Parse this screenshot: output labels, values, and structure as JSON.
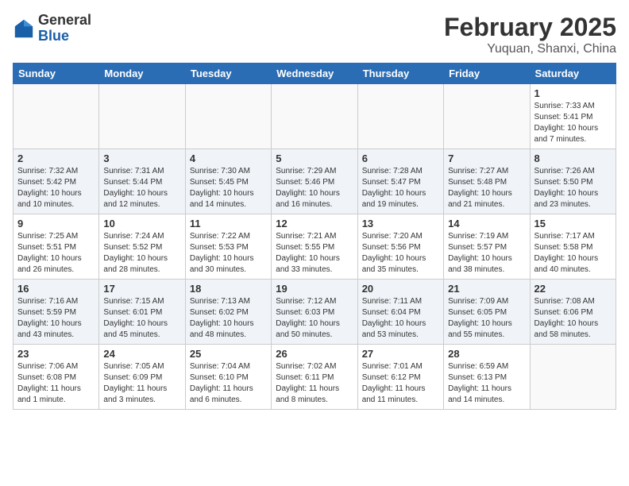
{
  "header": {
    "logo_general": "General",
    "logo_blue": "Blue",
    "month": "February 2025",
    "location": "Yuquan, Shanxi, China"
  },
  "weekdays": [
    "Sunday",
    "Monday",
    "Tuesday",
    "Wednesday",
    "Thursday",
    "Friday",
    "Saturday"
  ],
  "weeks": [
    [
      {
        "day": "",
        "info": ""
      },
      {
        "day": "",
        "info": ""
      },
      {
        "day": "",
        "info": ""
      },
      {
        "day": "",
        "info": ""
      },
      {
        "day": "",
        "info": ""
      },
      {
        "day": "",
        "info": ""
      },
      {
        "day": "1",
        "info": "Sunrise: 7:33 AM\nSunset: 5:41 PM\nDaylight: 10 hours and 7 minutes."
      }
    ],
    [
      {
        "day": "2",
        "info": "Sunrise: 7:32 AM\nSunset: 5:42 PM\nDaylight: 10 hours and 10 minutes."
      },
      {
        "day": "3",
        "info": "Sunrise: 7:31 AM\nSunset: 5:44 PM\nDaylight: 10 hours and 12 minutes."
      },
      {
        "day": "4",
        "info": "Sunrise: 7:30 AM\nSunset: 5:45 PM\nDaylight: 10 hours and 14 minutes."
      },
      {
        "day": "5",
        "info": "Sunrise: 7:29 AM\nSunset: 5:46 PM\nDaylight: 10 hours and 16 minutes."
      },
      {
        "day": "6",
        "info": "Sunrise: 7:28 AM\nSunset: 5:47 PM\nDaylight: 10 hours and 19 minutes."
      },
      {
        "day": "7",
        "info": "Sunrise: 7:27 AM\nSunset: 5:48 PM\nDaylight: 10 hours and 21 minutes."
      },
      {
        "day": "8",
        "info": "Sunrise: 7:26 AM\nSunset: 5:50 PM\nDaylight: 10 hours and 23 minutes."
      }
    ],
    [
      {
        "day": "9",
        "info": "Sunrise: 7:25 AM\nSunset: 5:51 PM\nDaylight: 10 hours and 26 minutes."
      },
      {
        "day": "10",
        "info": "Sunrise: 7:24 AM\nSunset: 5:52 PM\nDaylight: 10 hours and 28 minutes."
      },
      {
        "day": "11",
        "info": "Sunrise: 7:22 AM\nSunset: 5:53 PM\nDaylight: 10 hours and 30 minutes."
      },
      {
        "day": "12",
        "info": "Sunrise: 7:21 AM\nSunset: 5:55 PM\nDaylight: 10 hours and 33 minutes."
      },
      {
        "day": "13",
        "info": "Sunrise: 7:20 AM\nSunset: 5:56 PM\nDaylight: 10 hours and 35 minutes."
      },
      {
        "day": "14",
        "info": "Sunrise: 7:19 AM\nSunset: 5:57 PM\nDaylight: 10 hours and 38 minutes."
      },
      {
        "day": "15",
        "info": "Sunrise: 7:17 AM\nSunset: 5:58 PM\nDaylight: 10 hours and 40 minutes."
      }
    ],
    [
      {
        "day": "16",
        "info": "Sunrise: 7:16 AM\nSunset: 5:59 PM\nDaylight: 10 hours and 43 minutes."
      },
      {
        "day": "17",
        "info": "Sunrise: 7:15 AM\nSunset: 6:01 PM\nDaylight: 10 hours and 45 minutes."
      },
      {
        "day": "18",
        "info": "Sunrise: 7:13 AM\nSunset: 6:02 PM\nDaylight: 10 hours and 48 minutes."
      },
      {
        "day": "19",
        "info": "Sunrise: 7:12 AM\nSunset: 6:03 PM\nDaylight: 10 hours and 50 minutes."
      },
      {
        "day": "20",
        "info": "Sunrise: 7:11 AM\nSunset: 6:04 PM\nDaylight: 10 hours and 53 minutes."
      },
      {
        "day": "21",
        "info": "Sunrise: 7:09 AM\nSunset: 6:05 PM\nDaylight: 10 hours and 55 minutes."
      },
      {
        "day": "22",
        "info": "Sunrise: 7:08 AM\nSunset: 6:06 PM\nDaylight: 10 hours and 58 minutes."
      }
    ],
    [
      {
        "day": "23",
        "info": "Sunrise: 7:06 AM\nSunset: 6:08 PM\nDaylight: 11 hours and 1 minute."
      },
      {
        "day": "24",
        "info": "Sunrise: 7:05 AM\nSunset: 6:09 PM\nDaylight: 11 hours and 3 minutes."
      },
      {
        "day": "25",
        "info": "Sunrise: 7:04 AM\nSunset: 6:10 PM\nDaylight: 11 hours and 6 minutes."
      },
      {
        "day": "26",
        "info": "Sunrise: 7:02 AM\nSunset: 6:11 PM\nDaylight: 11 hours and 8 minutes."
      },
      {
        "day": "27",
        "info": "Sunrise: 7:01 AM\nSunset: 6:12 PM\nDaylight: 11 hours and 11 minutes."
      },
      {
        "day": "28",
        "info": "Sunrise: 6:59 AM\nSunset: 6:13 PM\nDaylight: 11 hours and 14 minutes."
      },
      {
        "day": "",
        "info": ""
      }
    ]
  ]
}
